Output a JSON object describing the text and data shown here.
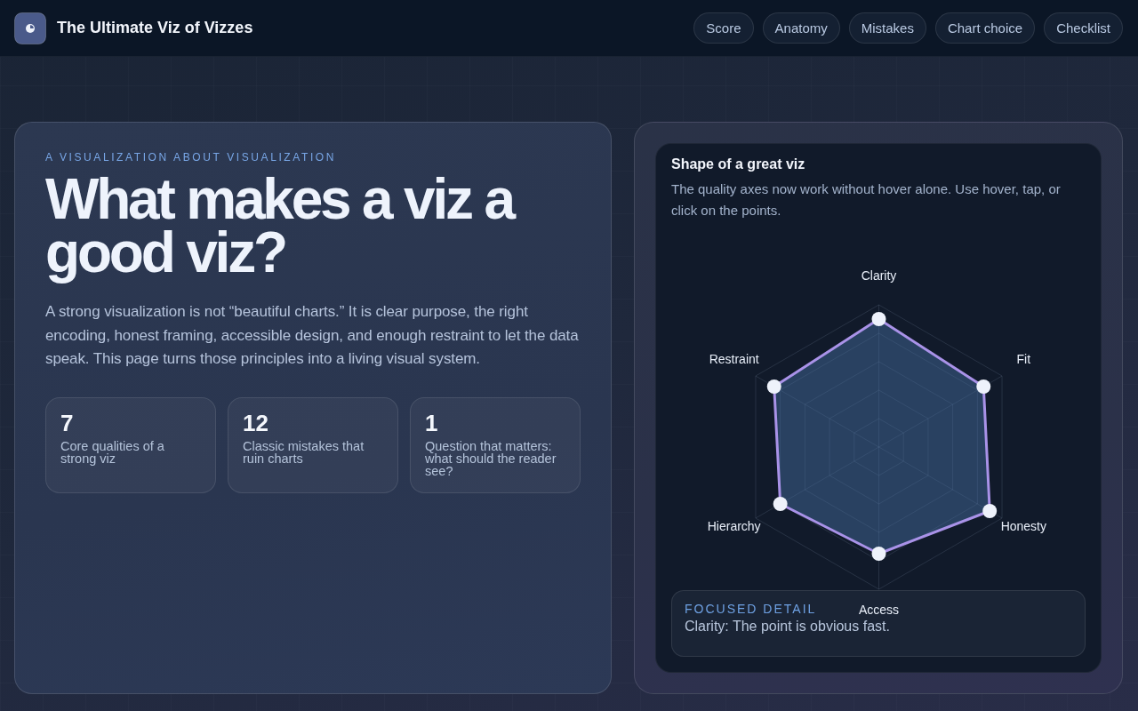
{
  "header": {
    "title": "The Ultimate Viz of Vizzes",
    "nav": [
      "Score",
      "Anatomy",
      "Mistakes",
      "Chart choice",
      "Checklist"
    ]
  },
  "hero": {
    "eyebrow": "A VISUALIZATION ABOUT VISUALIZATION",
    "heading": "What makes a viz a good viz?",
    "intro": "A strong visualization is not “beautiful charts.” It is clear purpose, the right encoding, honest framing, accessible design, and enough restraint to let the data speak. This page turns those principles into a living visual system.",
    "stats": [
      {
        "value": "7",
        "label": "Core qualities of a strong viz"
      },
      {
        "value": "12",
        "label": "Classic mistakes that ruin charts"
      },
      {
        "value": "1",
        "label": "Question that matters: what should the reader see?"
      }
    ]
  },
  "radar_panel": {
    "title": "Shape of a great viz",
    "description": "The quality axes now work without hover alone. Use hover, tap, or click on the points.",
    "axes": [
      "Clarity",
      "Fit",
      "Honesty",
      "Access",
      "Hierarchy",
      "Restraint"
    ],
    "focused_detail": {
      "label": "FOCUSED DETAIL",
      "text": "Clarity: The point is obvious fast."
    }
  }
}
